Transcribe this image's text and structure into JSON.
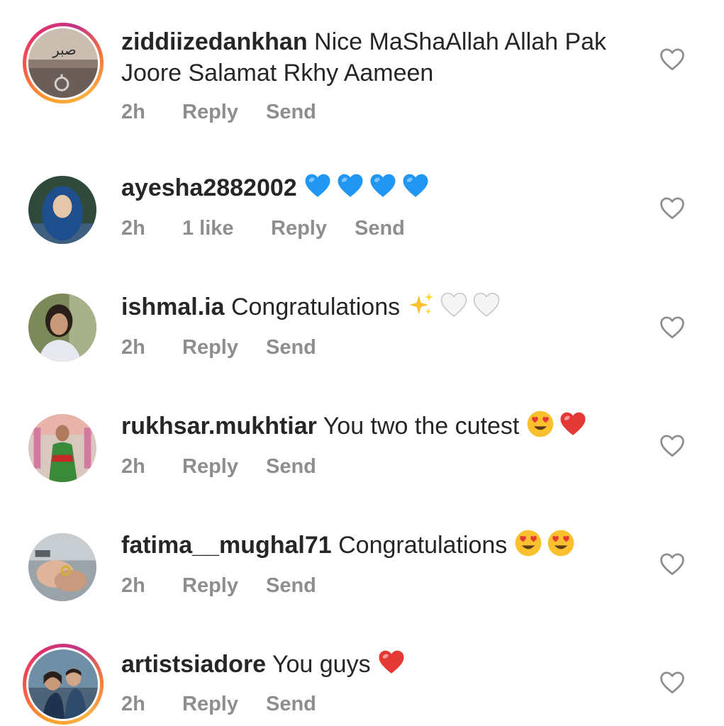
{
  "comments": [
    {
      "username": "ziddiizedankhan",
      "text_line1": "Nice MaShaAllah Allah Pak",
      "text_line2": "Joore Salamat Rkhy Aameen",
      "time": "2h",
      "reply": "Reply",
      "send": "Send",
      "has_story_ring": true
    },
    {
      "username": "ayesha2882002",
      "text": "",
      "emojis": [
        "blue-heart",
        "blue-heart",
        "blue-heart",
        "blue-heart"
      ],
      "time": "2h",
      "likes": "1 like",
      "reply": "Reply",
      "send": "Send",
      "has_story_ring": false
    },
    {
      "username": "ishmal.ia",
      "text": "Congratulations",
      "emojis": [
        "sparkles",
        "white-heart",
        "white-heart"
      ],
      "time": "2h",
      "reply": "Reply",
      "send": "Send",
      "has_story_ring": false
    },
    {
      "username": "rukhsar.mukhtiar",
      "text": "You two the cutest",
      "emojis": [
        "heart-eyes-face",
        "red-heart"
      ],
      "time": "2h",
      "reply": "Reply",
      "send": "Send",
      "has_story_ring": false
    },
    {
      "username": "fatima__mughal71",
      "text": "Congratulations",
      "emojis": [
        "heart-eyes-face",
        "heart-eyes-face"
      ],
      "time": "2h",
      "reply": "Reply",
      "send": "Send",
      "has_story_ring": false
    },
    {
      "username": "artistsiadore",
      "text": "You guys",
      "emojis": [
        "red-heart"
      ],
      "time": "2h",
      "reply": "Reply",
      "send": "Send",
      "has_story_ring": true
    }
  ],
  "colors": {
    "text": "#262626",
    "meta": "#8e8e8e",
    "heart_outline": "#8e8e8e",
    "blue_heart": "#2196f3",
    "red_heart": "#e53935"
  }
}
